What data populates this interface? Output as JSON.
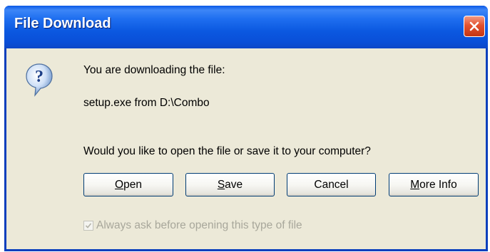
{
  "window": {
    "title": "File Download"
  },
  "dialog": {
    "line1": "You are downloading the file:",
    "line2": "setup.exe from D:\\Combo",
    "question": "Would you like to open the file or save it to your computer?"
  },
  "buttons": {
    "open": {
      "accel": "O",
      "rest": "pen"
    },
    "save": {
      "accel": "S",
      "rest": "ave"
    },
    "cancel": "Cancel",
    "more_info": {
      "accel": "M",
      "rest": "ore Info"
    }
  },
  "checkbox": {
    "label": "Always ask before opening this type of file",
    "checked": true,
    "enabled": false
  },
  "icons": {
    "dialog_icon": "question-icon",
    "close": "close-icon"
  },
  "colors": {
    "title_bar": "#0b58e0",
    "client": "#ece9d8",
    "close_button": "#e3522f"
  }
}
